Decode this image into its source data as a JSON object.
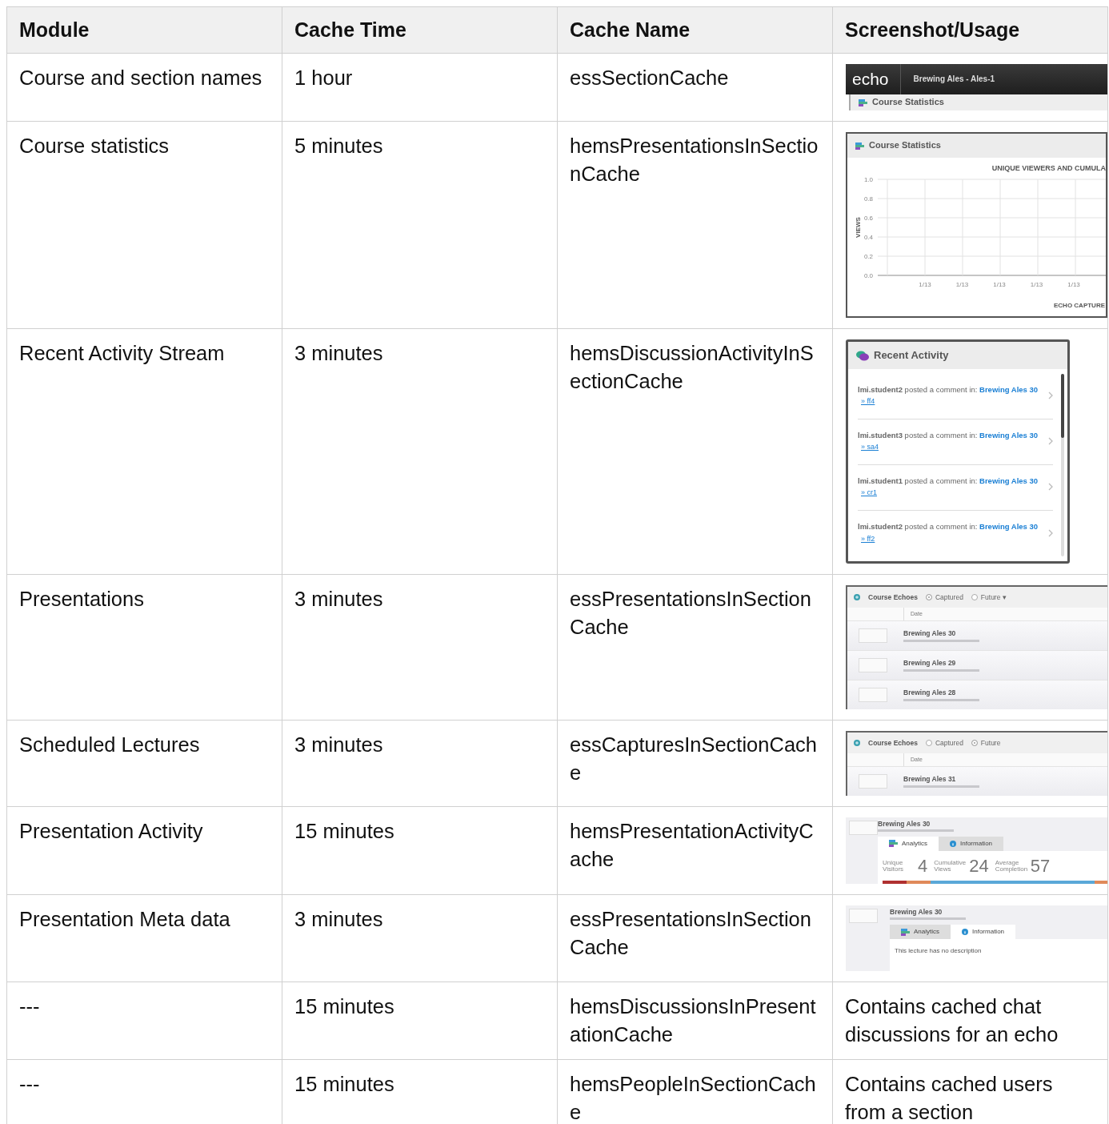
{
  "table": {
    "columns": [
      "Module",
      "Cache Time",
      "Cache Name",
      "Screenshot/Usage"
    ],
    "rows": [
      {
        "module": "Course and section names",
        "cache_time": "1 hour",
        "cache_name": "essSectionCache",
        "usage": {
          "kind": "screenshot",
          "preview": {
            "kind": "header",
            "logo": "echo",
            "title": "Brewing Ales - Ales-1",
            "panel_title": "Course Statistics"
          }
        }
      },
      {
        "module": "Course statistics",
        "cache_time": "5 minutes",
        "cache_name": "hemsPresentationsInSectionCache",
        "usage": {
          "kind": "screenshot",
          "preview": {
            "kind": "chart",
            "title": "Course Statistics",
            "chart_title": "UNIQUE VIEWERS AND CUMULA",
            "ylabel": "VIEWS",
            "yticks": [
              "1.0",
              "0.8",
              "0.6",
              "0.4",
              "0.2",
              "0.0"
            ],
            "xticks": [
              "1/13",
              "1/13",
              "1/13",
              "1/13",
              "1/13"
            ],
            "xlabel": "ECHO CAPTURE"
          }
        }
      },
      {
        "module": "Recent Activity Stream",
        "cache_time": "3 minutes",
        "cache_name": "hemsDiscussionActivityInSectionCache",
        "usage": {
          "kind": "screenshot",
          "preview": {
            "kind": "activity",
            "title": "Recent Activity",
            "items": [
              {
                "text": "**lmi.student2** posted a comment in:",
                "link": "Brewing Ales 30",
                "sub": "» ff4"
              },
              {
                "text": "**lmi.student3** posted a comment in:",
                "link": "Brewing Ales 30",
                "sub": "» sa4"
              },
              {
                "text": "**lmi.student1** posted a comment in:",
                "link": "Brewing Ales 30",
                "sub": "» cr1"
              },
              {
                "text": "**lmi.student2** posted a comment in:",
                "link": "Brewing Ales 30",
                "sub": "» ff2"
              }
            ]
          }
        }
      },
      {
        "module": "Presentations",
        "cache_time": "3 minutes",
        "cache_name": "essPresentationsInSectionCache",
        "usage": {
          "kind": "screenshot",
          "preview": {
            "kind": "echo_list",
            "title": "Course Echoes",
            "options": [
              {
                "label": "Captured",
                "selected": true
              },
              {
                "label": "Future ▾",
                "selected": false
              }
            ],
            "column": "Date",
            "items": [
              {
                "title": "Brewing Ales 30"
              },
              {
                "title": "Brewing Ales 29"
              },
              {
                "title": "Brewing Ales 28"
              }
            ]
          }
        }
      },
      {
        "module": "Scheduled Lectures",
        "cache_time": "3 minutes",
        "cache_name": "essCapturesInSectionCache",
        "usage": {
          "kind": "screenshot",
          "preview": {
            "kind": "echo_list",
            "title": "Course Echoes",
            "options": [
              {
                "label": "Captured",
                "selected": false
              },
              {
                "label": "Future",
                "selected": true
              }
            ],
            "column": "Date",
            "items": [
              {
                "title": "Brewing Ales 31"
              }
            ]
          }
        }
      },
      {
        "module": "Presentation Activity",
        "cache_time": "15 minutes",
        "cache_name": "hemsPresentationActivityCache",
        "usage": {
          "kind": "screenshot",
          "preview": {
            "kind": "presentation",
            "title": "Brewing Ales 30",
            "tabs": [
              {
                "label": "Analytics",
                "selected": true
              },
              {
                "label": "Information",
                "selected": false
              }
            ],
            "stats": [
              {
                "label": "Unique Visitors",
                "value": "4"
              },
              {
                "label": "Cumulative Views",
                "value": "24"
              },
              {
                "label": "Average Completion",
                "value": "57"
              }
            ]
          }
        }
      },
      {
        "module": "Presentation Meta data",
        "cache_time": "3 minutes",
        "cache_name": "essPresentationsInSectionCache",
        "usage": {
          "kind": "screenshot",
          "preview": {
            "kind": "presentation",
            "title": "Brewing Ales 30",
            "tabs": [
              {
                "label": "Analytics",
                "selected": false
              },
              {
                "label": "Information",
                "selected": true
              }
            ],
            "description": "This lecture has no description"
          }
        }
      },
      {
        "module": "---",
        "cache_time": "15 minutes",
        "cache_name": "hemsDiscussionsInPresentationCache",
        "usage": {
          "kind": "text",
          "text": "Contains cached chat discussions for an echo"
        }
      },
      {
        "module": "---",
        "cache_time": "15 minutes",
        "cache_name": "hemsPeopleInSectionCache",
        "usage": {
          "kind": "text",
          "text": "Contains cached users from a section"
        }
      }
    ]
  }
}
